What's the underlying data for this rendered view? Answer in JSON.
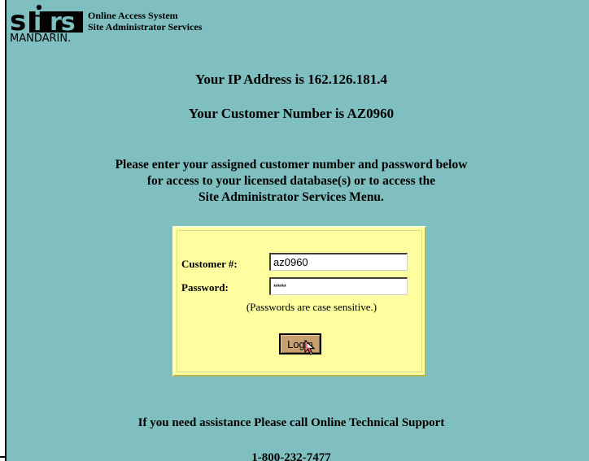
{
  "header": {
    "logo_main": "sirs",
    "logo_brand": "MANDARIN.",
    "system_line1": "Online Access System",
    "system_line2": "Site Administrator Services"
  },
  "info": {
    "ip_line": "Your IP Address is 162.126.181.4",
    "customer_line": "Your Customer Number is AZ0960"
  },
  "instructions": {
    "line1": "Please enter your assigned customer number and password below",
    "line2": "for access to your licensed database(s) or to access the",
    "line3": "Site Administrator Services Menu."
  },
  "login": {
    "customer_label": "Customer #:",
    "customer_value": "az0960",
    "password_label": "Password:",
    "password_value": "******",
    "case_note": "(Passwords are case sensitive.)",
    "button_label": "Login"
  },
  "footer": {
    "support": "If you need assistance Please call Online Technical Support",
    "phone": "1-800-232-7477"
  },
  "colors": {
    "page_background": "#7fbfbf",
    "login_box": "#ffff9f",
    "login_button": "#c8a070"
  }
}
